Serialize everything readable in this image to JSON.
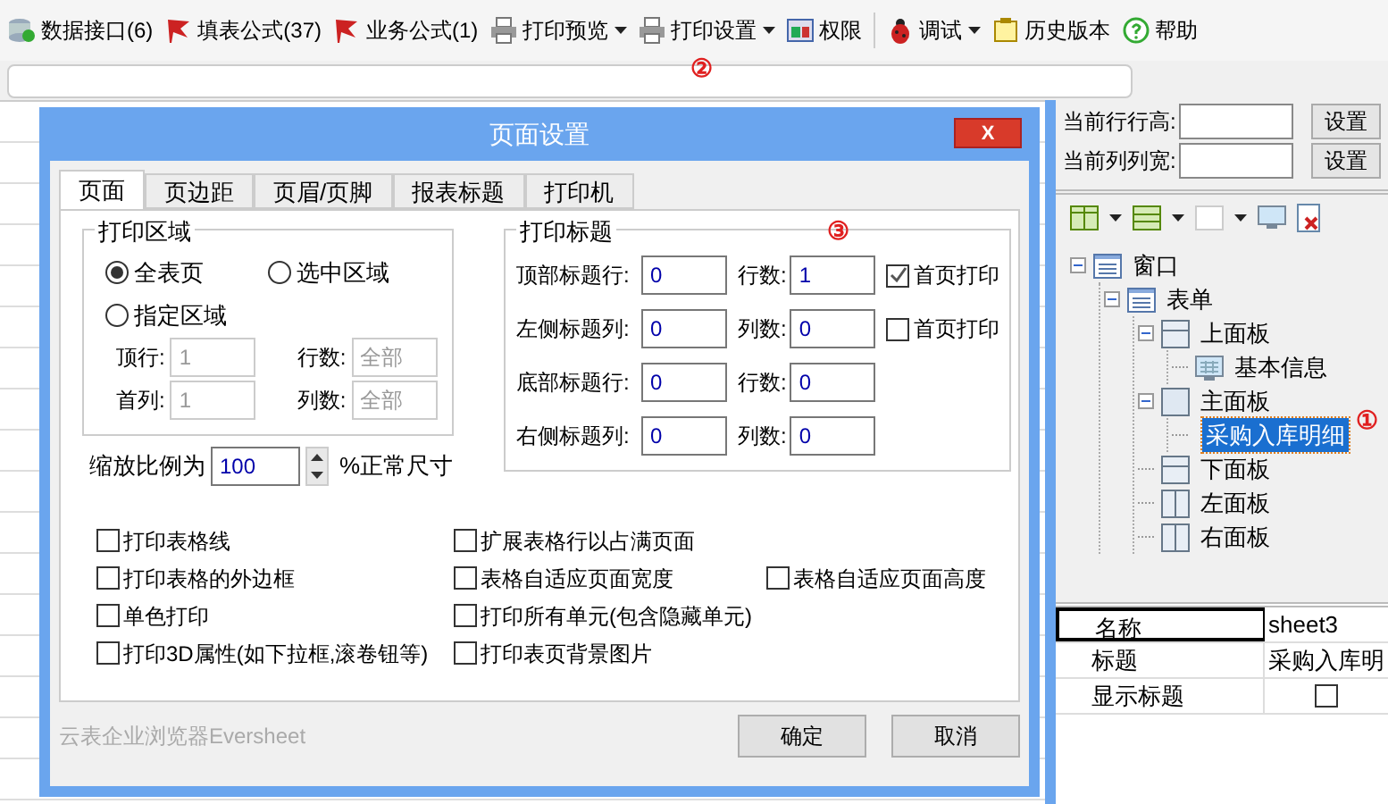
{
  "toolbar": [
    {
      "label": "数据接口(6)",
      "kind": "db",
      "dropdown": false
    },
    {
      "label": "填表公式(37)",
      "kind": "flag",
      "dropdown": false
    },
    {
      "label": "业务公式(1)",
      "kind": "flag",
      "dropdown": false
    },
    {
      "label": "打印预览",
      "kind": "printer",
      "dropdown": true
    },
    {
      "label": "打印设置",
      "kind": "printer",
      "dropdown": true,
      "marker": "②"
    },
    {
      "label": "权限",
      "kind": "grid",
      "dropdown": false
    },
    {
      "label": "调试",
      "kind": "bug",
      "dropdown": true
    },
    {
      "label": "历史版本",
      "kind": "note",
      "dropdown": false
    },
    {
      "label": "帮助",
      "kind": "help",
      "dropdown": false
    }
  ],
  "dialog": {
    "title": "页面设置",
    "close": "X",
    "tabs": [
      {
        "label": "页面",
        "selected": true
      },
      {
        "label": "页边距",
        "selected": false
      },
      {
        "label": "页眉/页脚",
        "selected": false
      },
      {
        "label": "报表标题",
        "selected": false
      },
      {
        "label": "打印机",
        "selected": false
      }
    ],
    "print_area": {
      "title": "打印区域",
      "options": [
        {
          "label": "全表页",
          "selected": true
        },
        {
          "label": "选中区域",
          "selected": false
        },
        {
          "label": "指定区域",
          "selected": false
        }
      ],
      "fields": [
        {
          "label": "顶行:",
          "value": "1"
        },
        {
          "label": "行数:",
          "value": "全部"
        },
        {
          "label": "首列:",
          "value": "1"
        },
        {
          "label": "列数:",
          "value": "全部"
        }
      ]
    },
    "scale": {
      "label": "缩放比例为",
      "value": "100",
      "suffix": "%正常尺寸"
    },
    "print_titles": {
      "title": "打印标题",
      "marker": "③",
      "rows": [
        {
          "label": "顶部标题行:",
          "value": "0",
          "count_label": "行数:",
          "count": "1",
          "first_page": {
            "label": "首页打印",
            "checked": true
          }
        },
        {
          "label": "左侧标题列:",
          "value": "0",
          "count_label": "列数:",
          "count": "0",
          "first_page": {
            "label": "首页打印",
            "checked": false
          }
        },
        {
          "label": "底部标题行:",
          "value": "0",
          "count_label": "行数:",
          "count": "0"
        },
        {
          "label": "右侧标题列:",
          "value": "0",
          "count_label": "列数:",
          "count": "0"
        }
      ]
    },
    "options": [
      {
        "kind": "checkbox",
        "label": "打印表格线",
        "checked": false
      },
      {
        "kind": "checkbox",
        "label": "扩展表格行以占满页面",
        "checked": false
      },
      {
        "kind": "gap"
      },
      {
        "kind": "checkbox",
        "label": "打印表格的外边框",
        "checked": false
      },
      {
        "kind": "checkbox",
        "label": "表格自适应页面宽度",
        "checked": false
      },
      {
        "kind": "checkbox",
        "label": "表格自适应页面高度",
        "checked": false
      },
      {
        "kind": "checkbox",
        "label": "单色打印",
        "checked": false
      },
      {
        "kind": "checkbox",
        "label": "打印所有单元(包含隐藏单元)",
        "checked": false
      },
      {
        "kind": "gap"
      },
      {
        "kind": "checkbox",
        "label": "打印3D属性(如下拉框,滚卷钮等)",
        "checked": false
      },
      {
        "kind": "checkbox",
        "label": "打印表页背景图片",
        "checked": false
      }
    ],
    "brand": "云表企业浏览器Eversheet",
    "buttons": [
      "确定",
      "取消"
    ]
  },
  "side": {
    "fields": [
      {
        "label": "当前行行高:",
        "button": "设置"
      },
      {
        "label": "当前列列宽:",
        "button": "设置"
      }
    ],
    "tree": [
      {
        "label": "窗口",
        "kind": "list",
        "expanded": true,
        "selected": false,
        "children": [
          {
            "label": "表单",
            "kind": "list",
            "expanded": true,
            "selected": false,
            "children": [
              {
                "label": "上面板",
                "kind": "hpanel",
                "expanded": true,
                "selected": false,
                "children": [
                  {
                    "label": "基本信息",
                    "kind": "sheet",
                    "selected": false
                  }
                ]
              },
              {
                "label": "主面板",
                "kind": "panel",
                "expanded": true,
                "selected": false,
                "children": [
                  {
                    "label": "采购入库明细",
                    "kind": "sheet",
                    "selected": true,
                    "marker": "①"
                  }
                ]
              },
              {
                "label": "下面板",
                "kind": "hpanel",
                "selected": false
              },
              {
                "label": "左面板",
                "kind": "vpanel",
                "selected": false
              },
              {
                "label": "右面板",
                "kind": "vpanel",
                "selected": false
              }
            ]
          }
        ]
      }
    ],
    "properties": [
      {
        "name": "名称",
        "kind": "text",
        "value": "sheet3"
      },
      {
        "name": "标题",
        "kind": "text",
        "value": "采购入库明"
      },
      {
        "name": "显示标题",
        "kind": "checkbox",
        "checked": false
      }
    ]
  }
}
